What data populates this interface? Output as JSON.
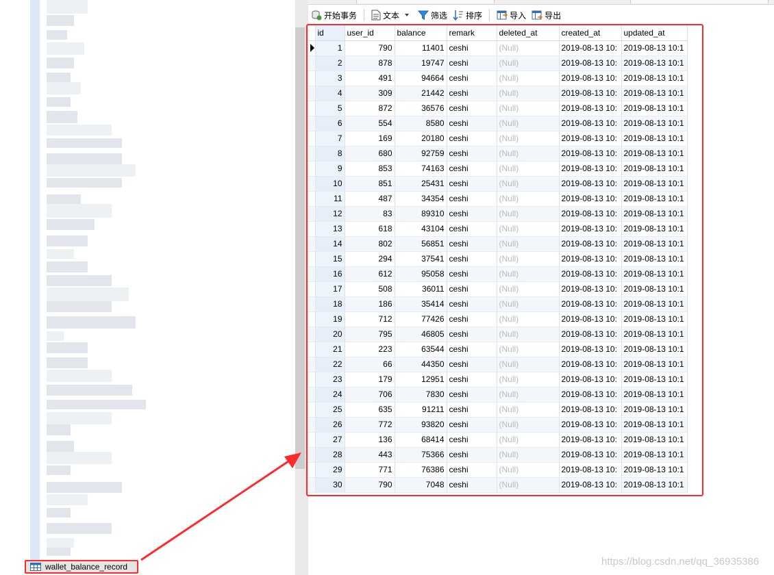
{
  "sidebar": {
    "highlighted_table": "wallet_balance_record"
  },
  "toolbar": {
    "items": [
      {
        "label": "开始事务",
        "icon": "begin-transaction-icon"
      },
      {
        "label": "文本",
        "icon": "text-icon",
        "dropdown": true
      },
      {
        "label": "筛选",
        "icon": "filter-icon"
      },
      {
        "label": "排序",
        "icon": "sort-icon"
      },
      {
        "label": "导入",
        "icon": "import-icon"
      },
      {
        "label": "导出",
        "icon": "export-icon"
      }
    ]
  },
  "grid": {
    "columns": [
      "id",
      "user_id",
      "balance",
      "remark",
      "deleted_at",
      "created_at",
      "updated_at"
    ],
    "rows": [
      [
        "1",
        "790",
        "11401",
        "ceshi",
        "(Null)",
        "2019-08-13 10:",
        "2019-08-13 10:1"
      ],
      [
        "2",
        "878",
        "19747",
        "ceshi",
        "(Null)",
        "2019-08-13 10:",
        "2019-08-13 10:1"
      ],
      [
        "3",
        "491",
        "94664",
        "ceshi",
        "(Null)",
        "2019-08-13 10:",
        "2019-08-13 10:1"
      ],
      [
        "4",
        "309",
        "21442",
        "ceshi",
        "(Null)",
        "2019-08-13 10:",
        "2019-08-13 10:1"
      ],
      [
        "5",
        "872",
        "36576",
        "ceshi",
        "(Null)",
        "2019-08-13 10:",
        "2019-08-13 10:1"
      ],
      [
        "6",
        "554",
        "8580",
        "ceshi",
        "(Null)",
        "2019-08-13 10:",
        "2019-08-13 10:1"
      ],
      [
        "7",
        "169",
        "20180",
        "ceshi",
        "(Null)",
        "2019-08-13 10:",
        "2019-08-13 10:1"
      ],
      [
        "8",
        "680",
        "92759",
        "ceshi",
        "(Null)",
        "2019-08-13 10:",
        "2019-08-13 10:1"
      ],
      [
        "9",
        "853",
        "74163",
        "ceshi",
        "(Null)",
        "2019-08-13 10:",
        "2019-08-13 10:1"
      ],
      [
        "10",
        "851",
        "25431",
        "ceshi",
        "(Null)",
        "2019-08-13 10:",
        "2019-08-13 10:1"
      ],
      [
        "11",
        "487",
        "34354",
        "ceshi",
        "(Null)",
        "2019-08-13 10:",
        "2019-08-13 10:1"
      ],
      [
        "12",
        "83",
        "89310",
        "ceshi",
        "(Null)",
        "2019-08-13 10:",
        "2019-08-13 10:1"
      ],
      [
        "13",
        "618",
        "43104",
        "ceshi",
        "(Null)",
        "2019-08-13 10:",
        "2019-08-13 10:1"
      ],
      [
        "14",
        "802",
        "56851",
        "ceshi",
        "(Null)",
        "2019-08-13 10:",
        "2019-08-13 10:1"
      ],
      [
        "15",
        "294",
        "37541",
        "ceshi",
        "(Null)",
        "2019-08-13 10:",
        "2019-08-13 10:1"
      ],
      [
        "16",
        "612",
        "95058",
        "ceshi",
        "(Null)",
        "2019-08-13 10:",
        "2019-08-13 10:1"
      ],
      [
        "17",
        "508",
        "36011",
        "ceshi",
        "(Null)",
        "2019-08-13 10:",
        "2019-08-13 10:1"
      ],
      [
        "18",
        "186",
        "35414",
        "ceshi",
        "(Null)",
        "2019-08-13 10:",
        "2019-08-13 10:1"
      ],
      [
        "19",
        "712",
        "77426",
        "ceshi",
        "(Null)",
        "2019-08-13 10:",
        "2019-08-13 10:1"
      ],
      [
        "20",
        "795",
        "46805",
        "ceshi",
        "(Null)",
        "2019-08-13 10:",
        "2019-08-13 10:1"
      ],
      [
        "21",
        "223",
        "63544",
        "ceshi",
        "(Null)",
        "2019-08-13 10:",
        "2019-08-13 10:1"
      ],
      [
        "22",
        "66",
        "44350",
        "ceshi",
        "(Null)",
        "2019-08-13 10:",
        "2019-08-13 10:1"
      ],
      [
        "23",
        "179",
        "12951",
        "ceshi",
        "(Null)",
        "2019-08-13 10:",
        "2019-08-13 10:1"
      ],
      [
        "24",
        "706",
        "7830",
        "ceshi",
        "(Null)",
        "2019-08-13 10:",
        "2019-08-13 10:1"
      ],
      [
        "25",
        "635",
        "91211",
        "ceshi",
        "(Null)",
        "2019-08-13 10:",
        "2019-08-13 10:1"
      ],
      [
        "26",
        "772",
        "93820",
        "ceshi",
        "(Null)",
        "2019-08-13 10:",
        "2019-08-13 10:1"
      ],
      [
        "27",
        "136",
        "68414",
        "ceshi",
        "(Null)",
        "2019-08-13 10:",
        "2019-08-13 10:1"
      ],
      [
        "28",
        "443",
        "75366",
        "ceshi",
        "(Null)",
        "2019-08-13 10:",
        "2019-08-13 10:1"
      ],
      [
        "29",
        "771",
        "76386",
        "ceshi",
        "(Null)",
        "2019-08-13 10:",
        "2019-08-13 10:1"
      ],
      [
        "30",
        "790",
        "7048",
        "ceshi",
        "(Null)",
        "2019-08-13 10:",
        "2019-08-13 10:1"
      ]
    ]
  },
  "watermark": "https://blog.csdn.net/qq_36935386",
  "colors": {
    "annotation_red": "#ff2a2a",
    "null_text": "#b9b9b9",
    "row_alt": "#f3f7fb"
  }
}
